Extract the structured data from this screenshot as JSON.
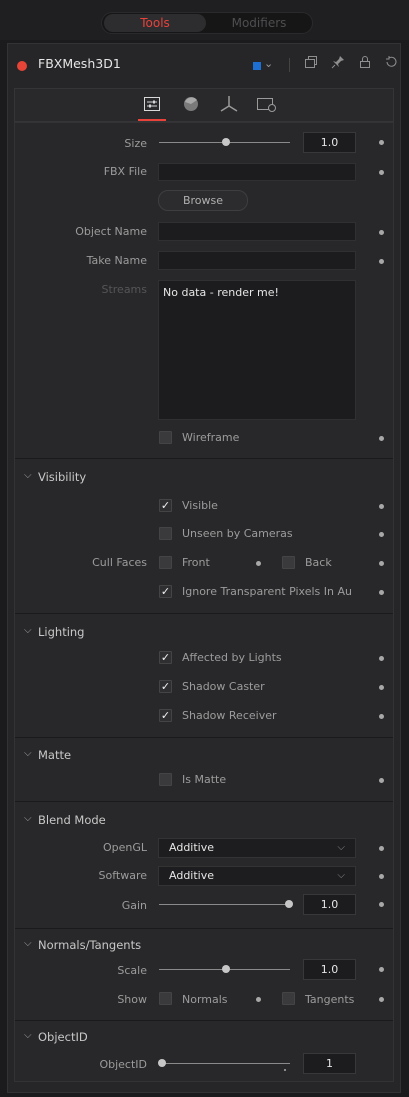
{
  "top_tabs": {
    "tools": "Tools",
    "modifiers": "Modifiers"
  },
  "header": {
    "title": "FBXMesh3D1",
    "color": "#1d6fd1"
  },
  "controls": {
    "size": {
      "label": "Size",
      "value": "1.0",
      "fraction": 0.5
    },
    "fbx_file": {
      "label": "FBX File",
      "value": ""
    },
    "browse": "Browse",
    "object_name": {
      "label": "Object Name",
      "value": ""
    },
    "take_name": {
      "label": "Take Name",
      "value": ""
    },
    "streams": {
      "label": "Streams",
      "text": "No data - render me!"
    },
    "wireframe": {
      "label": "Wireframe",
      "checked": false
    }
  },
  "visibility": {
    "title": "Visibility",
    "visible": {
      "label": "Visible",
      "checked": true
    },
    "unseen": {
      "label": "Unseen by Cameras",
      "checked": false
    },
    "cull_faces": {
      "label": "Cull Faces",
      "front": "Front",
      "back": "Back"
    },
    "ignore_transparent": {
      "label": "Ignore Transparent Pixels In Au",
      "checked": true
    }
  },
  "lighting": {
    "title": "Lighting",
    "affected": {
      "label": "Affected by Lights",
      "checked": true
    },
    "caster": {
      "label": "Shadow Caster",
      "checked": true
    },
    "receiver": {
      "label": "Shadow Receiver",
      "checked": true
    }
  },
  "matte": {
    "title": "Matte",
    "is_matte": {
      "label": "Is Matte",
      "checked": false
    }
  },
  "blend_mode": {
    "title": "Blend Mode",
    "opengl": {
      "label": "OpenGL",
      "value": "Additive"
    },
    "software": {
      "label": "Software",
      "value": "Additive"
    },
    "gain": {
      "label": "Gain",
      "value": "1.0",
      "fraction": 1.0
    }
  },
  "normals": {
    "title": "Normals/Tangents",
    "scale": {
      "label": "Scale",
      "value": "1.0",
      "fraction": 0.5
    },
    "show": {
      "label": "Show",
      "normals": "Normals",
      "tangents": "Tangents"
    }
  },
  "objectid": {
    "title": "ObjectID",
    "objectid": {
      "label": "ObjectID",
      "value": "1",
      "fraction": 0.0
    }
  }
}
